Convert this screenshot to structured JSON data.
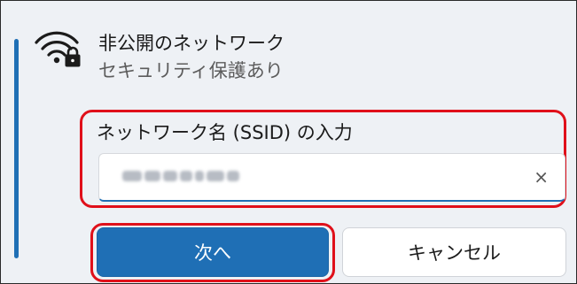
{
  "network": {
    "name": "非公開のネットワーク",
    "status": "セキュリティ保護あり",
    "icon": "wifi-lock-icon"
  },
  "ssid": {
    "label": "ネットワーク名 (SSID) の入力",
    "clear_icon": "×",
    "value_obscured": true
  },
  "buttons": {
    "next": "次へ",
    "cancel": "キャンセル"
  },
  "colors": {
    "accent": "#1f6fb5",
    "highlight": "#e0101a",
    "panel": "#eef1f5"
  }
}
